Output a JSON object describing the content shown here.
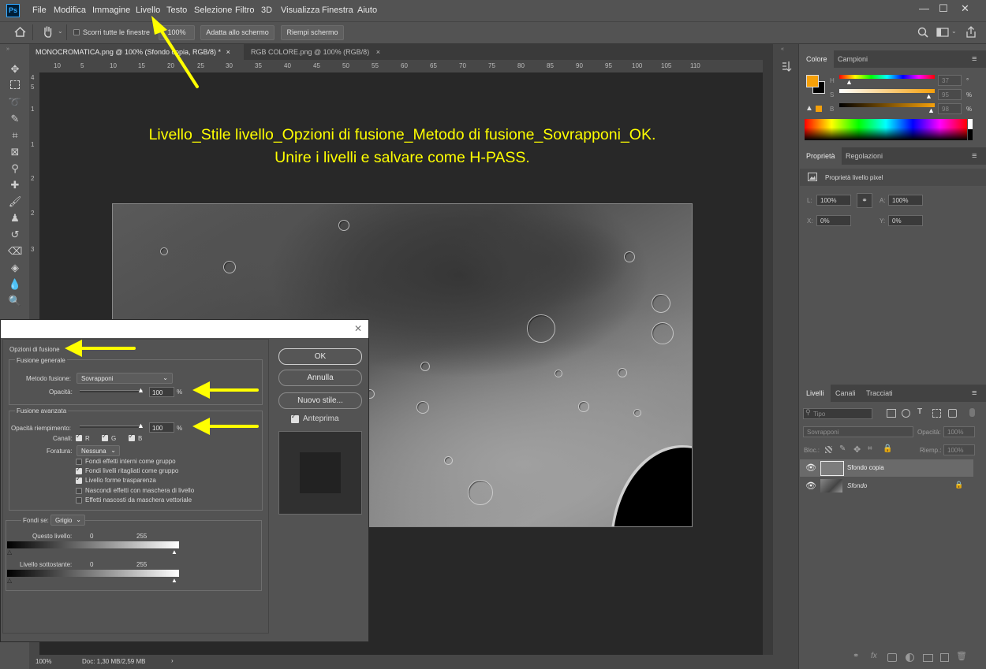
{
  "app": {
    "logo": "Ps"
  },
  "menu": [
    "File",
    "Modifica",
    "Immagine",
    "Livello",
    "Testo",
    "Selezione",
    "Filtro",
    "3D",
    "Visualizza",
    "Finestra",
    "Aiuto"
  ],
  "window_controls": [
    "—",
    "☐",
    "✕"
  ],
  "options_bar": {
    "scroll_all_label": "Scorri tutte le finestre",
    "zoom_value": "100%",
    "fit_screen_label": "Adatta allo schermo",
    "fill_screen_label": "Riempi schermo"
  },
  "tabs": [
    {
      "label": "MONOCROMATICA.png @ 100% (Sfondo copia, RGB/8) *",
      "close": "×",
      "active": true
    },
    {
      "label": "RGB COLORE.png @ 100% (RGB/8)",
      "close": "×",
      "active": false
    }
  ],
  "ruler_ticks": [
    "10",
    "5",
    "10",
    "15",
    "20",
    "25",
    "30",
    "35",
    "40",
    "45",
    "50",
    "55",
    "60",
    "65",
    "70",
    "75",
    "80",
    "85",
    "90",
    "95",
    "100",
    "105",
    "110"
  ],
  "ruler_v_ticks": [
    "4",
    "5",
    "1",
    "1",
    "2",
    "2",
    "3"
  ],
  "instruction": {
    "line1": "Livello_Stile livello_Opzioni di fusione_Metodo di fusione_Sovrapponi_OK.",
    "line2": "Unire i livelli e salvare come H-PASS."
  },
  "status": {
    "zoom": "100%",
    "doc": "Doc: 1,30 MB/2,59 MB",
    "arrow": "›"
  },
  "color_panel": {
    "tabs": [
      "Colore",
      "Campioni"
    ],
    "channels": [
      {
        "label": "H",
        "value": "37",
        "unit": "°"
      },
      {
        "label": "S",
        "value": "95",
        "unit": "%"
      },
      {
        "label": "B",
        "value": "98",
        "unit": "%"
      }
    ],
    "foreground": "#f5a00a",
    "background": "#000000"
  },
  "properties_panel": {
    "tabs": [
      "Proprietà",
      "Regolazioni"
    ],
    "title": "Proprietà livello pixel",
    "w_label": "L:",
    "w_value": "100%",
    "h_label": "A:",
    "h_value": "100%",
    "x_label": "X:",
    "x_value": "0%",
    "y_label": "Y:",
    "y_value": "0%"
  },
  "layers_panel": {
    "tabs": [
      "Livelli",
      "Canali",
      "Tracciati"
    ],
    "search_placeholder": "Tipo",
    "blend_mode": "Sovrapponi",
    "opacity_label": "Opacità:",
    "opacity_value": "100%",
    "lock_label": "Bloc.:",
    "fill_label": "Riemp.:",
    "fill_value": "100%",
    "layers": [
      {
        "name": "Sfondo copia",
        "selected": true
      },
      {
        "name": "Sfondo",
        "selected": false
      }
    ]
  },
  "dialog": {
    "close": "✕",
    "section_title": "Opzioni di fusione",
    "general_group": "Fusione generale",
    "blend_label": "Metodo fusione:",
    "blend_value": "Sovrapponi",
    "opacity_label": "Opacità:",
    "opacity_value": "100",
    "percent": "%",
    "advanced_group": "Fusione avanzata",
    "fill_opacity_label": "Opacità riempimento:",
    "fill_opacity_value": "100",
    "channels_label": "Canali:",
    "channel_r": "R",
    "channel_g": "G",
    "channel_b": "B",
    "knockout_label": "Foratura:",
    "knockout_value": "Nessuna",
    "options": [
      {
        "label": "Fondi effetti interni come gruppo",
        "checked": false
      },
      {
        "label": "Fondi livelli ritagliati come gruppo",
        "checked": true
      },
      {
        "label": "Livello forme trasparenza",
        "checked": true
      },
      {
        "label": "Nascondi effetti con maschera di livello",
        "checked": false
      },
      {
        "label": "Effetti nascosti da maschera vettoriale",
        "checked": false
      }
    ],
    "blend_if_label": "Fondi se:",
    "blend_if_value": "Grigio",
    "this_layer_label": "Questo livello:",
    "underlying_label": "Livello sottostante:",
    "range_min": "0",
    "range_max": "255",
    "ok": "OK",
    "cancel": "Annulla",
    "new_style": "Nuovo stile...",
    "preview": "Anteprima"
  },
  "annotation_color": "#ffff00"
}
